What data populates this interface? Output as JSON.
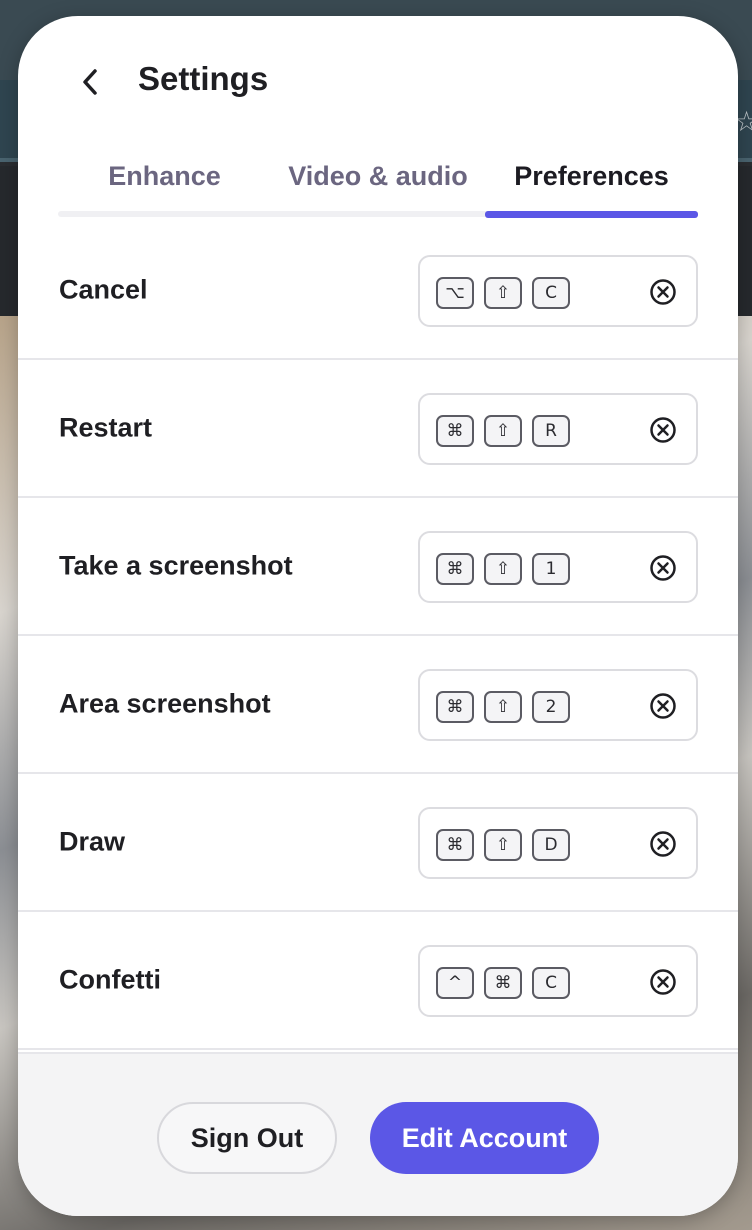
{
  "header": {
    "title": "Settings",
    "back_icon": "chevron-left-icon"
  },
  "tabs": [
    {
      "label": "Enhance",
      "active": false
    },
    {
      "label": "Video & audio",
      "active": false
    },
    {
      "label": "Preferences",
      "active": true
    }
  ],
  "accent_color": "#5b57e6",
  "shortcuts": [
    {
      "label": "Cancel",
      "keys": [
        "⌥",
        "⇧",
        "C"
      ]
    },
    {
      "label": "Restart",
      "keys": [
        "⌘",
        "⇧",
        "R"
      ]
    },
    {
      "label": "Take a screenshot",
      "keys": [
        "⌘",
        "⇧",
        "1"
      ]
    },
    {
      "label": "Area screenshot",
      "keys": [
        "⌘",
        "⇧",
        "2"
      ]
    },
    {
      "label": "Draw",
      "keys": [
        "⌘",
        "⇧",
        "D"
      ]
    },
    {
      "label": "Confetti",
      "keys": [
        "^",
        "⌘",
        "C"
      ]
    }
  ],
  "footer": {
    "sign_out_label": "Sign Out",
    "edit_account_label": "Edit Account"
  },
  "background": {
    "star_icon": "star-outline-icon"
  }
}
